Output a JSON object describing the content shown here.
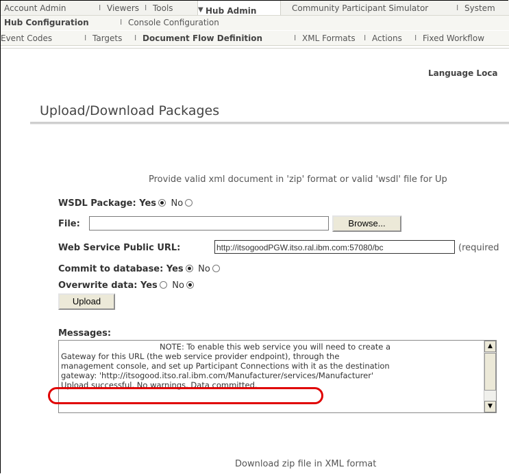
{
  "top_nav": {
    "items": [
      "Account Admin",
      "Viewers",
      "Tools",
      "Hub Admin",
      "Community Participant Simulator",
      "System"
    ],
    "active": "Hub Admin",
    "separator": "I",
    "active_arrow": "▼"
  },
  "sub_nav": {
    "items": [
      "Hub Configuration",
      "Console Configuration"
    ],
    "active": "Hub Configuration"
  },
  "third_nav": {
    "items": [
      "Event Codes",
      "Targets",
      "Document Flow Definition",
      "XML Formats",
      "Actions",
      "Fixed Workflow"
    ],
    "active": "Document Flow Definition"
  },
  "language_locale": "Language Loca",
  "page_title": "Upload/Download Packages",
  "intro_text": "Provide valid xml document in 'zip' format or valid 'wsdl' file for Up",
  "form": {
    "wsdl_package": {
      "label": "WSDL Package:",
      "yes": "Yes",
      "no": "No",
      "selected": "Yes"
    },
    "file": {
      "label": "File:",
      "value": "",
      "browse_label": "Browse..."
    },
    "ws_public_url": {
      "label": "Web Service Public URL:",
      "value": "http://itsogoodPGW.itso.ral.ibm.com:57080/bc",
      "required_note": "(required"
    },
    "commit_to_database": {
      "label": "Commit to database:",
      "yes": "Yes",
      "no": "No",
      "selected": "Yes"
    },
    "overwrite_data": {
      "label": "Overwrite data:",
      "yes": "Yes",
      "no": "No",
      "selected": "No"
    },
    "upload_label": "Upload"
  },
  "messages": {
    "label": "Messages:",
    "lines": [
      "NOTE: To enable this web service you will need to create a",
      "Gateway for this URL (the web service provider endpoint), through the",
      "management console, and set up Participant Connections with it as the destination",
      "gateway: 'http://itsogood.itso.ral.ibm.com/Manufacturer/services/Manufacturer'",
      "Upload successful. No warnings. Data committed."
    ]
  },
  "download_text": "Download zip file in XML format",
  "colors": {
    "highlight": "#e00000",
    "nav_bg": "#f2f2ee",
    "button_bg": "#ece9d8"
  }
}
